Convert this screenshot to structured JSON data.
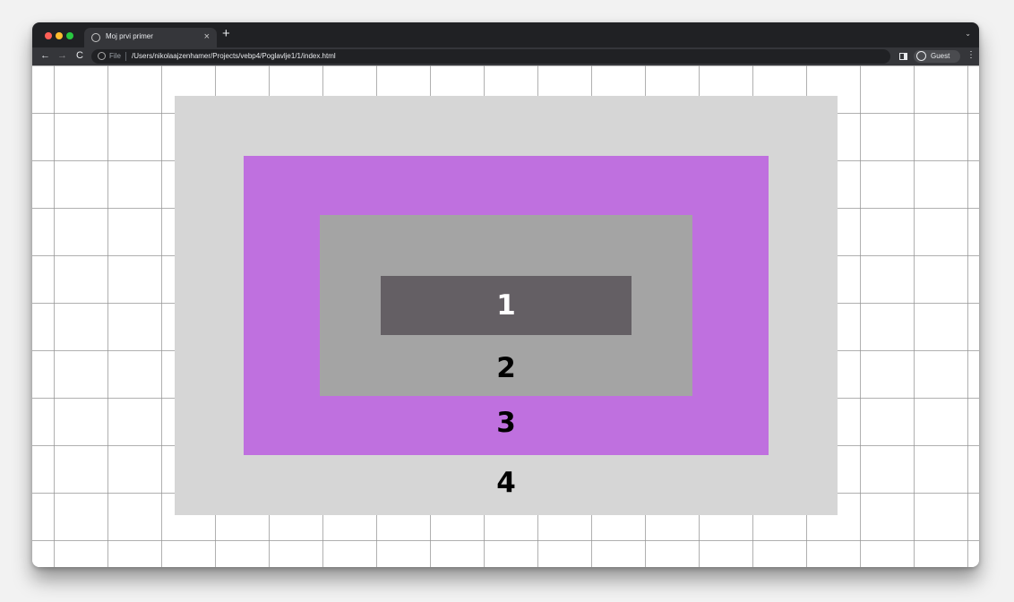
{
  "browser": {
    "tab_title": "Moj prvi primer",
    "tab_close": "×",
    "new_tab": "+",
    "tab_menu": "⌄",
    "nav_back": "←",
    "nav_forward": "→",
    "nav_reload": "C",
    "address_scheme": "File",
    "address_url": "/Users/nikolaajzenhamer/Projects/vebp4/Poglavlje1/1/index.html",
    "profile_label": "Guest",
    "menu_icon": "⋮"
  },
  "page": {
    "boxes": [
      {
        "label": "1",
        "color": "#645f64"
      },
      {
        "label": "2",
        "color": "#a4a4a4"
      },
      {
        "label": "3",
        "color": "#bf70df"
      },
      {
        "label": "4",
        "color": "#d6d6d6"
      }
    ]
  },
  "colors": {
    "chrome_dark": "#202124",
    "chrome_toolbar": "#35363a",
    "grid_line": "#969696"
  }
}
